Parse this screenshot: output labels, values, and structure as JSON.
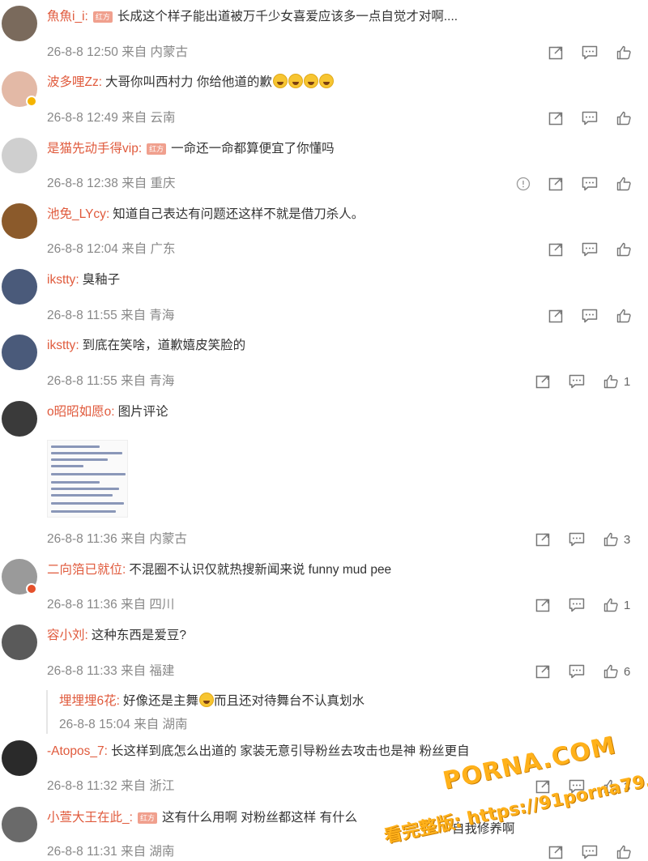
{
  "comments": [
    {
      "username": "魚魚i_i",
      "vip_badge": "红方",
      "text": "长成这个样子能出道被万千少女喜爱应该多一点自觉才对啊....",
      "time": "26-8-8 12:50",
      "from_label": "来自",
      "location": "内蒙古",
      "like_count": "",
      "emoji_count": 0,
      "has_report": false,
      "avatar_color": "#7a6a5c",
      "avatar_badge": ""
    },
    {
      "username": "波多哩Zz",
      "vip_badge": "",
      "text": "大哥你叫西村力 你给他道的歉",
      "time": "26-8-8 12:49",
      "from_label": "来自",
      "location": "云南",
      "like_count": "",
      "emoji_count": 4,
      "has_report": false,
      "avatar_color": "#e3b9a6",
      "avatar_badge": "gold"
    },
    {
      "username": "是猫先动手得vip",
      "vip_badge": "红方",
      "text": "一命还一命都算便宜了你懂吗",
      "time": "26-8-8 12:38",
      "from_label": "来自",
      "location": "重庆",
      "like_count": "",
      "emoji_count": 0,
      "has_report": true,
      "avatar_color": "#cfcfcf",
      "avatar_badge": ""
    },
    {
      "username": "池免_LYcy",
      "vip_badge": "",
      "text": "知道自己表达有问题还这样不就是借刀杀人。",
      "time": "26-8-8 12:04",
      "from_label": "来自",
      "location": "广东",
      "like_count": "",
      "emoji_count": 0,
      "has_report": false,
      "avatar_color": "#8b5a2b",
      "avatar_badge": ""
    },
    {
      "username": "ikstty",
      "vip_badge": "",
      "text": "臭釉子",
      "time": "26-8-8 11:55",
      "from_label": "来自",
      "location": "青海",
      "like_count": "",
      "emoji_count": 0,
      "has_report": false,
      "avatar_color": "#4a5a7a",
      "avatar_badge": ""
    },
    {
      "username": "ikstty",
      "vip_badge": "",
      "text": "到底在笑啥，道歉嬉皮笑脸的",
      "time": "26-8-8 11:55",
      "from_label": "来自",
      "location": "青海",
      "like_count": "1",
      "emoji_count": 0,
      "has_report": false,
      "avatar_color": "#4a5a7a",
      "avatar_badge": ""
    },
    {
      "username": "o昭昭如愿o",
      "vip_badge": "",
      "text": "图片评论",
      "time": "26-8-8 11:36",
      "from_label": "来自",
      "location": "内蒙古",
      "like_count": "3",
      "emoji_count": 0,
      "has_report": false,
      "avatar_color": "#3a3a3a",
      "avatar_badge": ""
    },
    {
      "username": "二向箔已就位",
      "vip_badge": "",
      "text": "不混圈不认识仅就热搜新闻来说 funny mud pee",
      "time": "26-8-8 11:36",
      "from_label": "来自",
      "location": "四川",
      "like_count": "1",
      "emoji_count": 0,
      "has_report": false,
      "avatar_color": "#9a9a9a",
      "avatar_badge": "red"
    },
    {
      "username": "容小刘",
      "vip_badge": "",
      "text": "这种东西是爱豆?",
      "time": "26-8-8 11:33",
      "from_label": "来自",
      "location": "福建",
      "like_count": "6",
      "emoji_count": 0,
      "has_report": false,
      "avatar_color": "#5a5a5a",
      "avatar_badge": ""
    },
    {
      "username": "-Atopos_7",
      "vip_badge": "",
      "text": "长这样到底怎么出道的  家装无意引导粉丝去攻击也是神 粉丝更自",
      "time": "26-8-8 11:32",
      "from_label": "来自",
      "location": "浙江",
      "like_count": "3",
      "emoji_count": 0,
      "has_report": false,
      "avatar_color": "#2a2a2a",
      "avatar_badge": ""
    },
    {
      "username": "小萱大王在此_",
      "vip_badge": "红方",
      "text": "这有什么用啊 对粉丝都这样 有什么",
      "time": "26-8-8 11:31",
      "from_label": "来自",
      "location": "湖南",
      "like_count": "",
      "emoji_count": 0,
      "has_report": false,
      "avatar_color": "#6a6a6a",
      "avatar_badge": ""
    }
  ],
  "reply": {
    "username": "埋埋埋6花",
    "text_before": "好像还是主舞",
    "text_after": "而且还对待舞台不认真划水",
    "time": "26-8-8 15:04",
    "from_label": "来自",
    "location": "湖南"
  },
  "overlap_text": "自我修养啊",
  "watermark": {
    "line1": "PORNA.COM",
    "line2": "看完整版: https://91porna79.com"
  }
}
